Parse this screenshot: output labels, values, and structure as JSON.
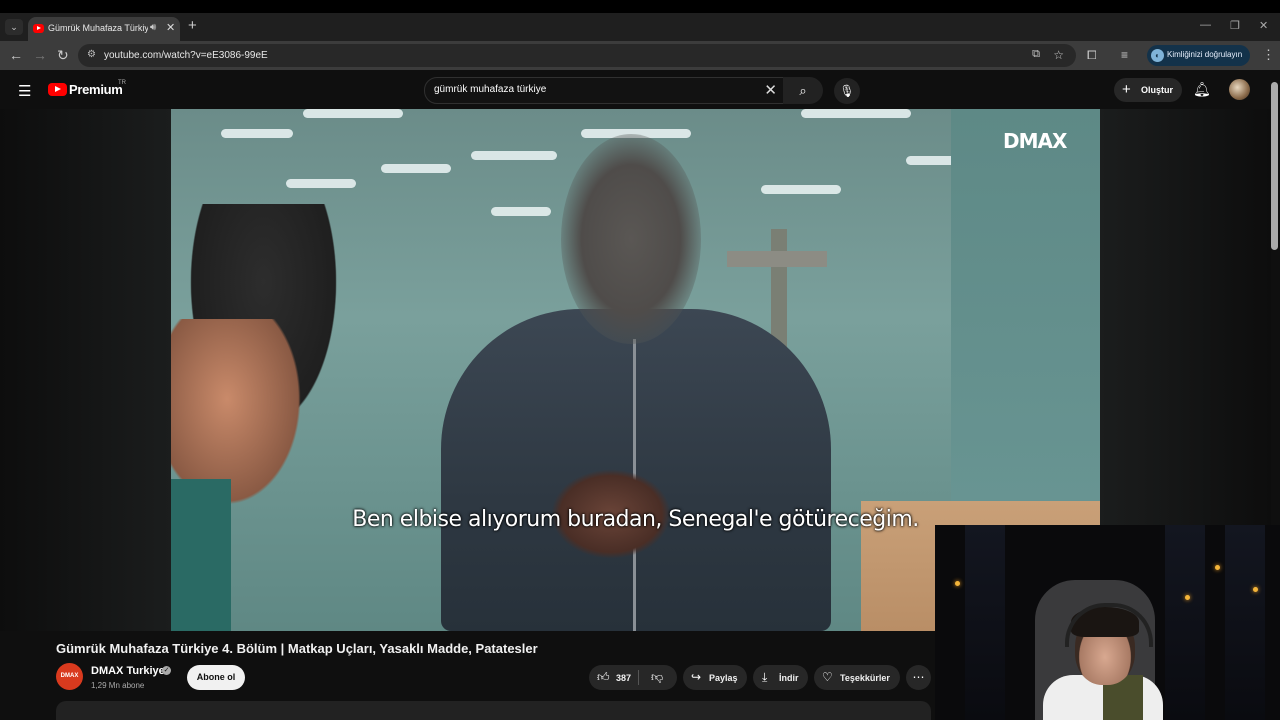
{
  "browser": {
    "tab_title": "Gümrük Muhafaza Türkiye -",
    "url": "youtube.com/watch?v=eE3086-99eE",
    "verify_label": "Kimliğinizi doğrulayın"
  },
  "youtube": {
    "logo_text": "Premium",
    "logo_region": "TR",
    "search_query": "gümrük muhafaza türkiye",
    "create_label": "Oluştur"
  },
  "video": {
    "subtitle": "Ben elbise alıyorum buradan, Senegal'e götüreceğim.",
    "watermark": "DMAX",
    "title": "Gümrük Muhafaza Türkiye 4. Bölüm | Matkap Uçları, Yasaklı Madde, Patatesler"
  },
  "channel": {
    "logo_text": "DMAX",
    "name": "DMAX Turkiye",
    "subscribers": "1,29 Mn abone",
    "subscribe_label": "Abone ol"
  },
  "actions": {
    "likes": "387",
    "share": "Paylaş",
    "download": "İndir",
    "thanks": "Teşekkürler"
  },
  "colors": {
    "youtube_red": "#ff0000",
    "background": "#0f0f0f",
    "pill": "#272727"
  }
}
